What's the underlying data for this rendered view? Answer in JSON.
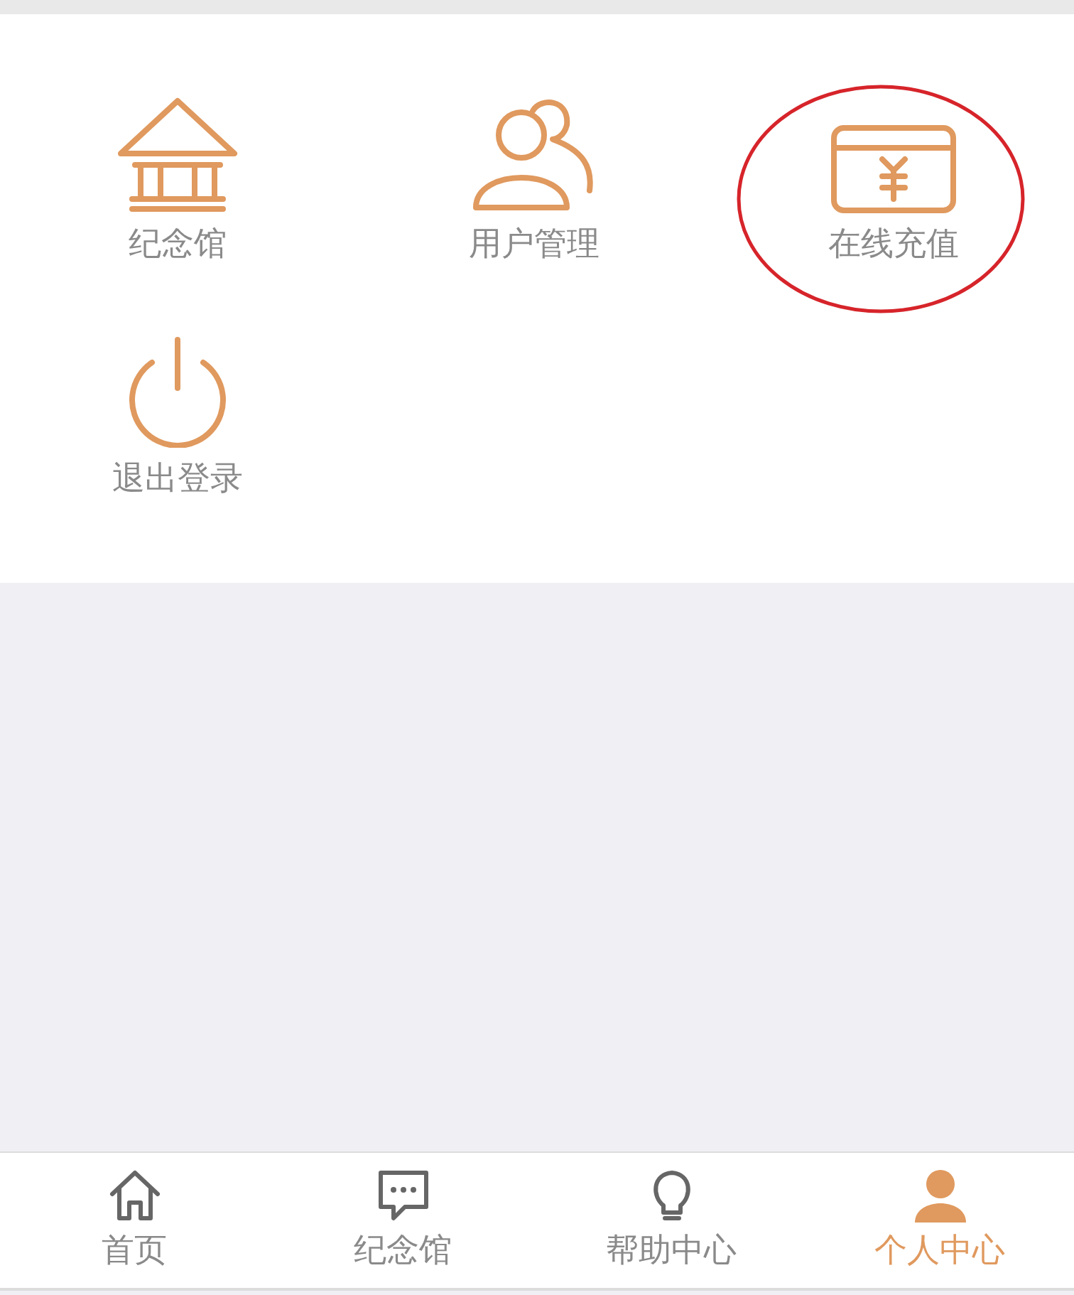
{
  "menu": [
    {
      "kind": "hall",
      "label": "纪念馆",
      "highlighted": false
    },
    {
      "kind": "users",
      "label": "用户管理",
      "highlighted": false
    },
    {
      "kind": "card",
      "label": "在线充值",
      "highlighted": true
    },
    {
      "kind": "power",
      "label": "退出登录",
      "highlighted": false
    }
  ],
  "tabs": [
    {
      "kind": "home",
      "label": "首页",
      "selected": false
    },
    {
      "kind": "chat",
      "label": "纪念馆",
      "selected": false
    },
    {
      "kind": "bulb",
      "label": "帮助中心",
      "selected": false
    },
    {
      "kind": "person",
      "label": "个人中心",
      "selected": true
    }
  ]
}
